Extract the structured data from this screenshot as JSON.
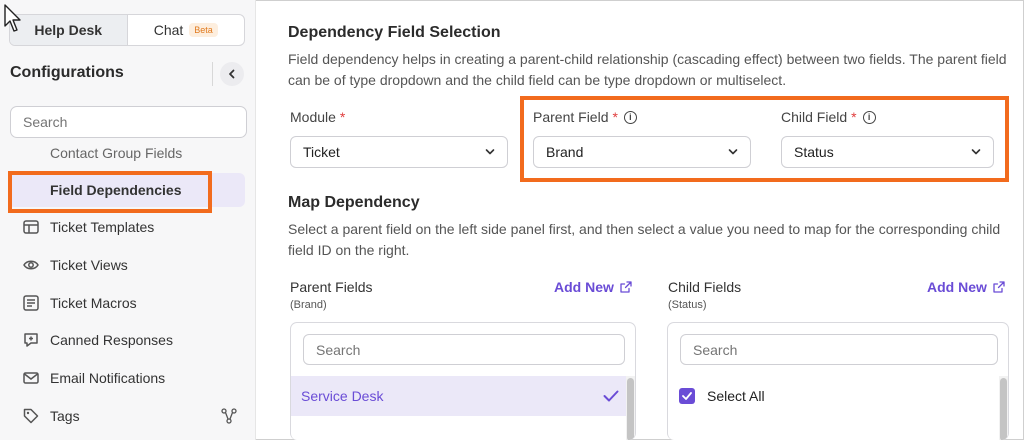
{
  "sidebar": {
    "tabs": [
      {
        "label": "Help Desk"
      },
      {
        "label": "Chat",
        "badge": "Beta"
      }
    ],
    "title": "Configurations",
    "search_placeholder": "Search",
    "items": [
      {
        "label": "Contact Group Fields",
        "icon": "group-icon"
      },
      {
        "label": "Field Dependencies",
        "icon": "dependency-icon",
        "active": true
      },
      {
        "label": "Ticket Templates",
        "icon": "template-icon"
      },
      {
        "label": "Ticket Views",
        "icon": "eye-icon"
      },
      {
        "label": "Ticket Macros",
        "icon": "macro-icon"
      },
      {
        "label": "Canned Responses",
        "icon": "canned-response-icon"
      },
      {
        "label": "Email Notifications",
        "icon": "email-notification-icon"
      },
      {
        "label": "Tags",
        "icon": "tag-icon"
      }
    ]
  },
  "main": {
    "title": "Dependency Field Selection",
    "description": "Field dependency helps in creating a parent-child relationship (cascading effect) between two fields. The parent field can be of type dropdown and the child field can be type dropdown or multiselect.",
    "module": {
      "label": "Module",
      "required": "*",
      "value": "Ticket"
    },
    "parent_field": {
      "label": "Parent Field",
      "required": "*",
      "value": "Brand"
    },
    "child_field": {
      "label": "Child Field",
      "required": "*",
      "value": "Status"
    },
    "map_title": "Map Dependency",
    "map_description": "Select a parent field on the left side panel first, and then select a value you need to map for the corresponding child field ID on the right.",
    "parent_fields": {
      "title": "Parent Fields",
      "subtitle": "(Brand)",
      "add_new": "Add New",
      "search_placeholder": "Search",
      "items": [
        {
          "label": "Service Desk",
          "selected": true
        }
      ]
    },
    "child_fields": {
      "title": "Child Fields",
      "subtitle": "(Status)",
      "add_new": "Add New",
      "search_placeholder": "Search",
      "items": [
        {
          "label": "Select All",
          "checked": true
        }
      ]
    }
  },
  "colors": {
    "accent": "#6a4cd6",
    "highlight": "#f26b1d",
    "required": "#e03d3d"
  }
}
